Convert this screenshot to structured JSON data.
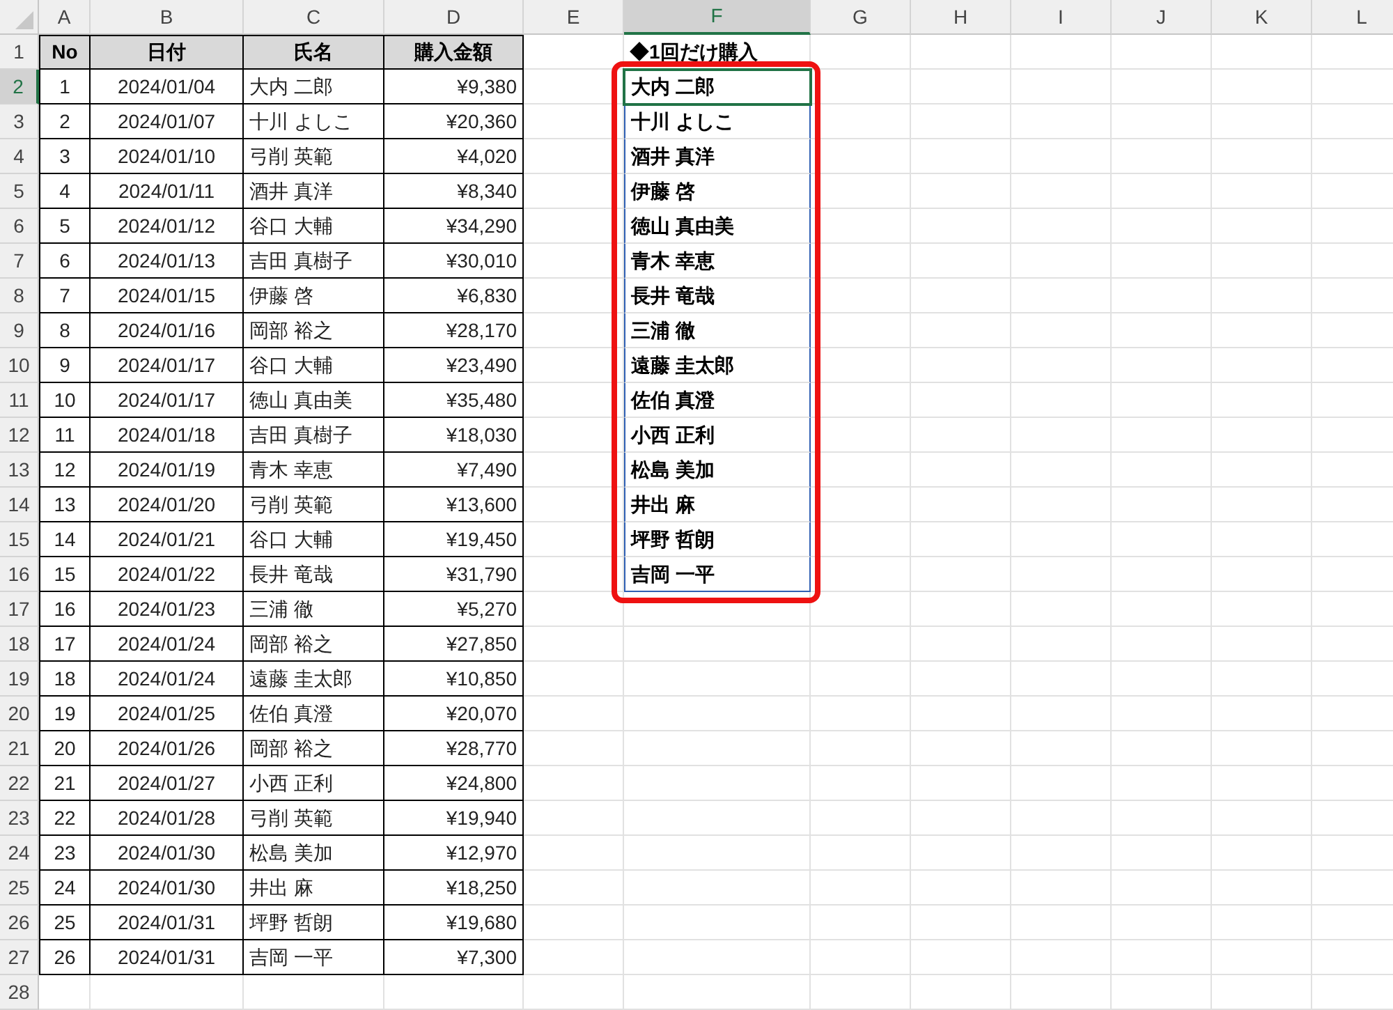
{
  "columns": [
    {
      "label": "A",
      "selected": false
    },
    {
      "label": "B",
      "selected": false
    },
    {
      "label": "C",
      "selected": false
    },
    {
      "label": "D",
      "selected": false
    },
    {
      "label": "E",
      "selected": false
    },
    {
      "label": "F",
      "selected": true
    },
    {
      "label": "G",
      "selected": false
    },
    {
      "label": "H",
      "selected": false
    },
    {
      "label": "I",
      "selected": false
    },
    {
      "label": "J",
      "selected": false
    },
    {
      "label": "K",
      "selected": false
    },
    {
      "label": "L",
      "selected": false
    }
  ],
  "rows": [
    {
      "label": "1",
      "selected": false
    },
    {
      "label": "2",
      "selected": true
    },
    {
      "label": "3",
      "selected": false
    },
    {
      "label": "4",
      "selected": false
    },
    {
      "label": "5",
      "selected": false
    },
    {
      "label": "6",
      "selected": false
    },
    {
      "label": "7",
      "selected": false
    },
    {
      "label": "8",
      "selected": false
    },
    {
      "label": "9",
      "selected": false
    },
    {
      "label": "10",
      "selected": false
    },
    {
      "label": "11",
      "selected": false
    },
    {
      "label": "12",
      "selected": false
    },
    {
      "label": "13",
      "selected": false
    },
    {
      "label": "14",
      "selected": false
    },
    {
      "label": "15",
      "selected": false
    },
    {
      "label": "16",
      "selected": false
    },
    {
      "label": "17",
      "selected": false
    },
    {
      "label": "18",
      "selected": false
    },
    {
      "label": "19",
      "selected": false
    },
    {
      "label": "20",
      "selected": false
    },
    {
      "label": "21",
      "selected": false
    },
    {
      "label": "22",
      "selected": false
    },
    {
      "label": "23",
      "selected": false
    },
    {
      "label": "24",
      "selected": false
    },
    {
      "label": "25",
      "selected": false
    },
    {
      "label": "26",
      "selected": false
    },
    {
      "label": "27",
      "selected": false
    },
    {
      "label": "28",
      "selected": false
    }
  ],
  "table": {
    "columns": [
      "No",
      "日付",
      "氏名",
      "購入金額"
    ],
    "rows": [
      [
        "1",
        "2024/01/04",
        "大内 二郎",
        "¥9,380"
      ],
      [
        "2",
        "2024/01/07",
        "十川 よしこ",
        "¥20,360"
      ],
      [
        "3",
        "2024/01/10",
        "弓削 英範",
        "¥4,020"
      ],
      [
        "4",
        "2024/01/11",
        "酒井 真洋",
        "¥8,340"
      ],
      [
        "5",
        "2024/01/12",
        "谷口 大輔",
        "¥34,290"
      ],
      [
        "6",
        "2024/01/13",
        "吉田 真樹子",
        "¥30,010"
      ],
      [
        "7",
        "2024/01/15",
        "伊藤 啓",
        "¥6,830"
      ],
      [
        "8",
        "2024/01/16",
        "岡部 裕之",
        "¥28,170"
      ],
      [
        "9",
        "2024/01/17",
        "谷口 大輔",
        "¥23,490"
      ],
      [
        "10",
        "2024/01/17",
        "徳山 真由美",
        "¥35,480"
      ],
      [
        "11",
        "2024/01/18",
        "吉田 真樹子",
        "¥18,030"
      ],
      [
        "12",
        "2024/01/19",
        "青木 幸恵",
        "¥7,490"
      ],
      [
        "13",
        "2024/01/20",
        "弓削 英範",
        "¥13,600"
      ],
      [
        "14",
        "2024/01/21",
        "谷口 大輔",
        "¥19,450"
      ],
      [
        "15",
        "2024/01/22",
        "長井 竜哉",
        "¥31,790"
      ],
      [
        "16",
        "2024/01/23",
        "三浦 徹",
        "¥5,270"
      ],
      [
        "17",
        "2024/01/24",
        "岡部 裕之",
        "¥27,850"
      ],
      [
        "18",
        "2024/01/24",
        "遠藤 圭太郎",
        "¥10,850"
      ],
      [
        "19",
        "2024/01/25",
        "佐伯 真澄",
        "¥20,070"
      ],
      [
        "20",
        "2024/01/26",
        "岡部 裕之",
        "¥28,770"
      ],
      [
        "21",
        "2024/01/27",
        "小西 正利",
        "¥24,800"
      ],
      [
        "22",
        "2024/01/28",
        "弓削 英範",
        "¥19,940"
      ],
      [
        "23",
        "2024/01/30",
        "松島 美加",
        "¥12,970"
      ],
      [
        "24",
        "2024/01/30",
        "井出 麻",
        "¥18,250"
      ],
      [
        "25",
        "2024/01/31",
        "坪野 哲朗",
        "¥19,680"
      ],
      [
        "26",
        "2024/01/31",
        "吉岡 一平",
        "¥7,300"
      ]
    ]
  },
  "result": {
    "title": "◆1回だけ購入",
    "items": [
      {
        "name": "大内 二郎",
        "selected": true
      },
      {
        "name": "十川 よしこ",
        "selected": false
      },
      {
        "name": "酒井 真洋",
        "selected": false
      },
      {
        "name": "伊藤 啓",
        "selected": false
      },
      {
        "name": "徳山 真由美",
        "selected": false
      },
      {
        "name": "青木 幸恵",
        "selected": false
      },
      {
        "name": "長井 竜哉",
        "selected": false
      },
      {
        "name": "三浦 徹",
        "selected": false
      },
      {
        "name": "遠藤 圭太郎",
        "selected": false
      },
      {
        "name": "佐伯 真澄",
        "selected": false
      },
      {
        "name": "小西 正利",
        "selected": false
      },
      {
        "name": "松島 美加",
        "selected": false
      },
      {
        "name": "井出 麻",
        "selected": false
      },
      {
        "name": "坪野 哲朗",
        "selected": false
      },
      {
        "name": "吉岡 一平",
        "selected": false
      }
    ]
  }
}
